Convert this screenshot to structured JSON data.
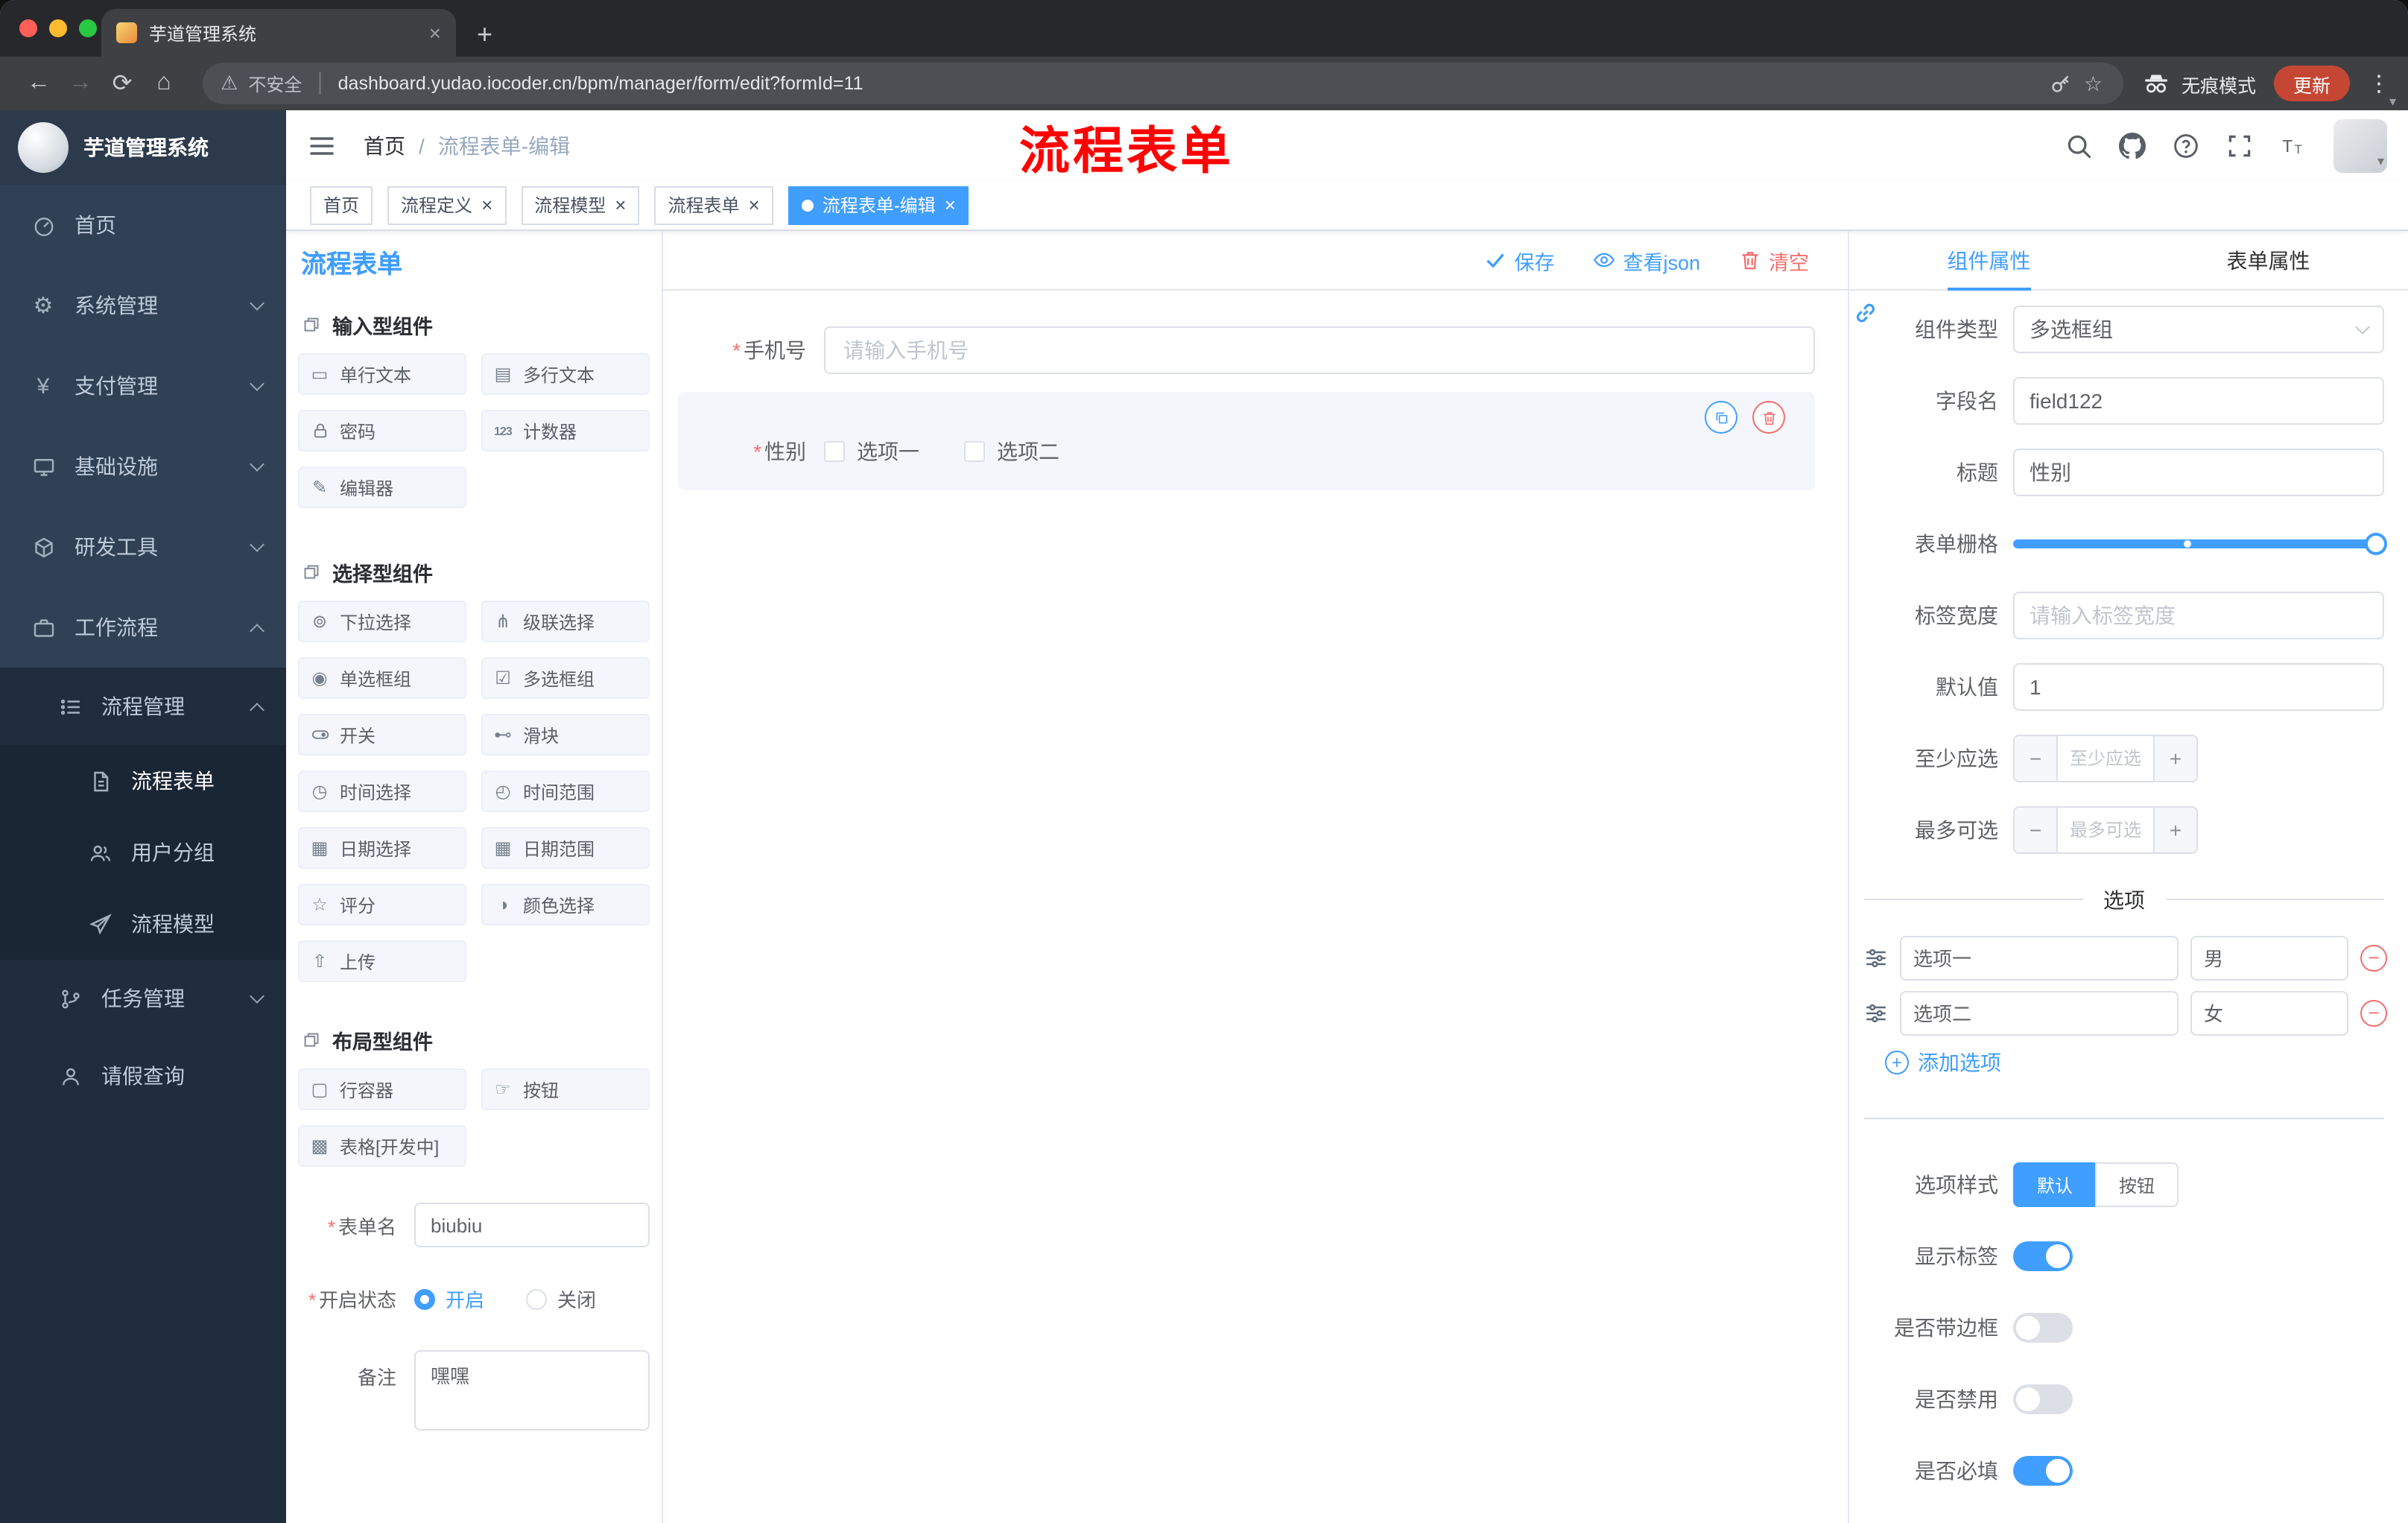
{
  "colors": {
    "primary": "#409EFF",
    "danger": "#F56C6C",
    "sidebar_bg": "#304156",
    "sidebar_sub_bg": "#1F2D3D",
    "annotation_red": "#FE0302",
    "update_button": "#C64634",
    "tag_active": "#409EFF"
  },
  "icons": {
    "back": "←",
    "forward": "→",
    "reload": "⟳",
    "warning": "⚠",
    "home": "⌂",
    "divider": "|",
    "star": "☆",
    "dots": "⋮",
    "caret": "▾",
    "newtab": "+",
    "close": "×",
    "gear": "⚙",
    "yen": "¥",
    "minus": "−",
    "plus": "+",
    "check": "✓",
    "chip_singleline": "▭",
    "chip_multiline": "▤",
    "chip_counter": "123",
    "chip_editor": "✎",
    "chip_select": "⊚",
    "chip_cascade": "⋔",
    "chip_radio": "◉",
    "chip_checkbox": "☑",
    "chip_slider": "⊷",
    "chip_time": "◷",
    "chip_timerange": "◴",
    "chip_date": "▦",
    "chip_daterange": "▦",
    "chip_rate": "☆",
    "chip_color": "◑",
    "chip_upload": "⇧",
    "chip_row": "▢",
    "chip_button": "☞",
    "chip_table": "▩"
  },
  "browser": {
    "tab_title": "芋道管理系统",
    "security_label": "不安全",
    "url": "dashboard.yudao.iocoder.cn/bpm/manager/form/edit?formId=11",
    "incognito_label": "无痕模式",
    "update_label": "更新"
  },
  "sidebar": {
    "logo_title": "芋道管理系统",
    "menu": {
      "home": "首页",
      "system": "系统管理",
      "payment": "支付管理",
      "infra": "基础设施",
      "devtool": "研发工具",
      "workflow": "工作流程",
      "process_mgmt": "流程管理",
      "process_form": "流程表单",
      "user_group": "用户分组",
      "process_model": "流程模型",
      "task_mgmt": "任务管理",
      "leave_query": "请假查询"
    }
  },
  "header": {
    "breadcrumb_home": "首页",
    "breadcrumb_sep": "/",
    "breadcrumb_current": "流程表单-编辑",
    "annotation": "流程表单"
  },
  "tags": [
    "首页",
    "流程定义",
    "流程模型",
    "流程表单",
    "流程表单-编辑"
  ],
  "designer": {
    "panel_title": "流程表单",
    "toolbar": {
      "save": "保存",
      "view_json": "查看json",
      "clear": "清空"
    },
    "groups": [
      {
        "title": "输入型组件",
        "items": [
          "单行文本",
          "多行文本",
          "密码",
          "计数器",
          "编辑器"
        ]
      },
      {
        "title": "选择型组件",
        "items": [
          "下拉选择",
          "级联选择",
          "单选框组",
          "多选框组",
          "开关",
          "滑块",
          "时间选择",
          "时间范围",
          "日期选择",
          "日期范围",
          "评分",
          "颜色选择",
          "上传"
        ]
      },
      {
        "title": "布局型组件",
        "items": [
          "行容器",
          "按钮",
          "表格[开发中]"
        ]
      }
    ],
    "meta": {
      "name_label": "表单名",
      "name_value": "biubiu",
      "status_label": "开启状态",
      "status_on": "开启",
      "status_off": "关闭",
      "remark_label": "备注",
      "remark_value": "嘿嘿"
    },
    "canvas": {
      "phone_label": "手机号",
      "phone_placeholder": "请输入手机号",
      "gender_label": "性别",
      "gender_opt1": "选项一",
      "gender_opt2": "选项二"
    }
  },
  "props": {
    "tabs": [
      "组件属性",
      "表单属性"
    ],
    "type_label": "组件类型",
    "type_value": "多选框组",
    "field_label": "字段名",
    "field_value": "field122",
    "title_label": "标题",
    "title_value": "性别",
    "grid_label": "表单栅格",
    "labelwidth_label": "标签宽度",
    "labelwidth_placeholder": "请输入标签宽度",
    "default_label": "默认值",
    "default_value": "1",
    "min_label": "至少应选",
    "min_placeholder": "至少应选",
    "max_label": "最多可选",
    "max_placeholder": "最多可选",
    "options_divider": "选项",
    "options": [
      {
        "label": "选项一",
        "value": "男"
      },
      {
        "label": "选项二",
        "value": "女"
      }
    ],
    "add_option": "添加选项",
    "style_label": "选项样式",
    "style_default": "默认",
    "style_button": "按钮",
    "switch_show_label": "显示标签",
    "switch_border": "是否带边框",
    "switch_disabled": "是否禁用",
    "switch_required": "是否必填",
    "switch_states": {
      "show_label": true,
      "border": false,
      "disabled": false,
      "required": true
    }
  }
}
